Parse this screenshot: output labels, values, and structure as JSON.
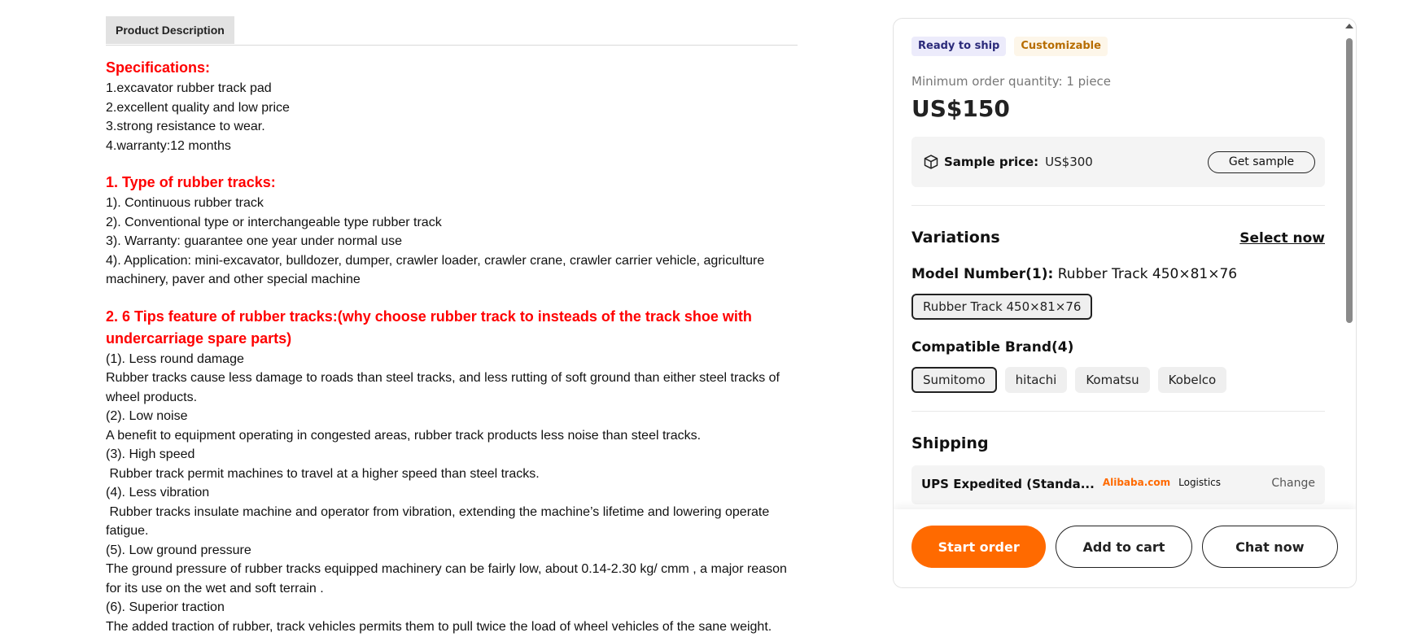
{
  "description": {
    "tab_label": "Product Description",
    "sections": [
      {
        "heading": "Specifications:",
        "lines": [
          "1.excavator rubber track pad",
          "2.excellent quality and low price",
          "3.strong resistance to wear.",
          "4.warranty:12 months"
        ]
      },
      {
        "heading": "1. Type of rubber tracks:",
        "lines": [
          "1). Continuous rubber track",
          "2). Conventional type or interchangeable type rubber track",
          "3). Warranty: guarantee one year under normal use",
          "4). Application: mini-excavator, bulldozer, dumper, crawler loader, crawler crane, crawler carrier vehicle, agriculture machinery, paver and other special machine"
        ]
      },
      {
        "heading": "2. 6 Tips feature of rubber tracks:(why choose rubber track to insteads of the track shoe with undercarriage spare parts)",
        "lines": [
          "(1). Less round damage",
          "Rubber tracks cause less damage to roads than steel tracks, and less rutting of soft ground than either steel tracks of wheel products.",
          "(2). Low noise",
          "A benefit to equipment operating in congested areas, rubber track products less noise than steel tracks.",
          "(3). High speed",
          " Rubber track permit machines to travel at a higher speed than steel tracks.",
          "(4). Less vibration",
          " Rubber tracks insulate machine and operator from vibration, extending the machine’s lifetime and lowering operate fatigue.",
          "(5). Low ground pressure",
          "The ground pressure of rubber tracks equipped machinery can be fairly low, about 0.14-2.30 kg/ cmm , a major reason for its use on the wet and soft terrain .",
          "(6). Superior traction",
          "The added traction of rubber, track vehicles permits them to pull twice the load of wheel vehicles of the sane weight."
        ]
      }
    ]
  },
  "panel": {
    "badge_ready": "Ready to ship",
    "badge_custom": "Customizable",
    "moq": "Minimum order quantity: 1 piece",
    "price": "US$150",
    "sample_label": "Sample price:",
    "sample_value": "US$300",
    "sample_button": "Get sample",
    "variations_title": "Variations",
    "select_now": "Select now",
    "model_label": "Model Number(1):",
    "model_value": "Rubber Track 450×81×76",
    "model_options": [
      "Rubber Track 450×81×76"
    ],
    "brand_label": "Compatible Brand(4)",
    "brand_options": [
      "Sumitomo",
      "hitachi",
      "Komatsu",
      "Kobelco"
    ],
    "shipping_title": "Shipping",
    "shipping_carrier": "UPS Expedited (Standa...",
    "shipping_ali": "Alibaba.com",
    "shipping_logistics": "Logistics",
    "shipping_change": "Change",
    "start_order": "Start order",
    "add_to_cart": "Add to cart",
    "chat_now": "Chat now"
  },
  "colors": {
    "heading_red": "#ff0000",
    "accent_orange": "#ff6a00"
  }
}
